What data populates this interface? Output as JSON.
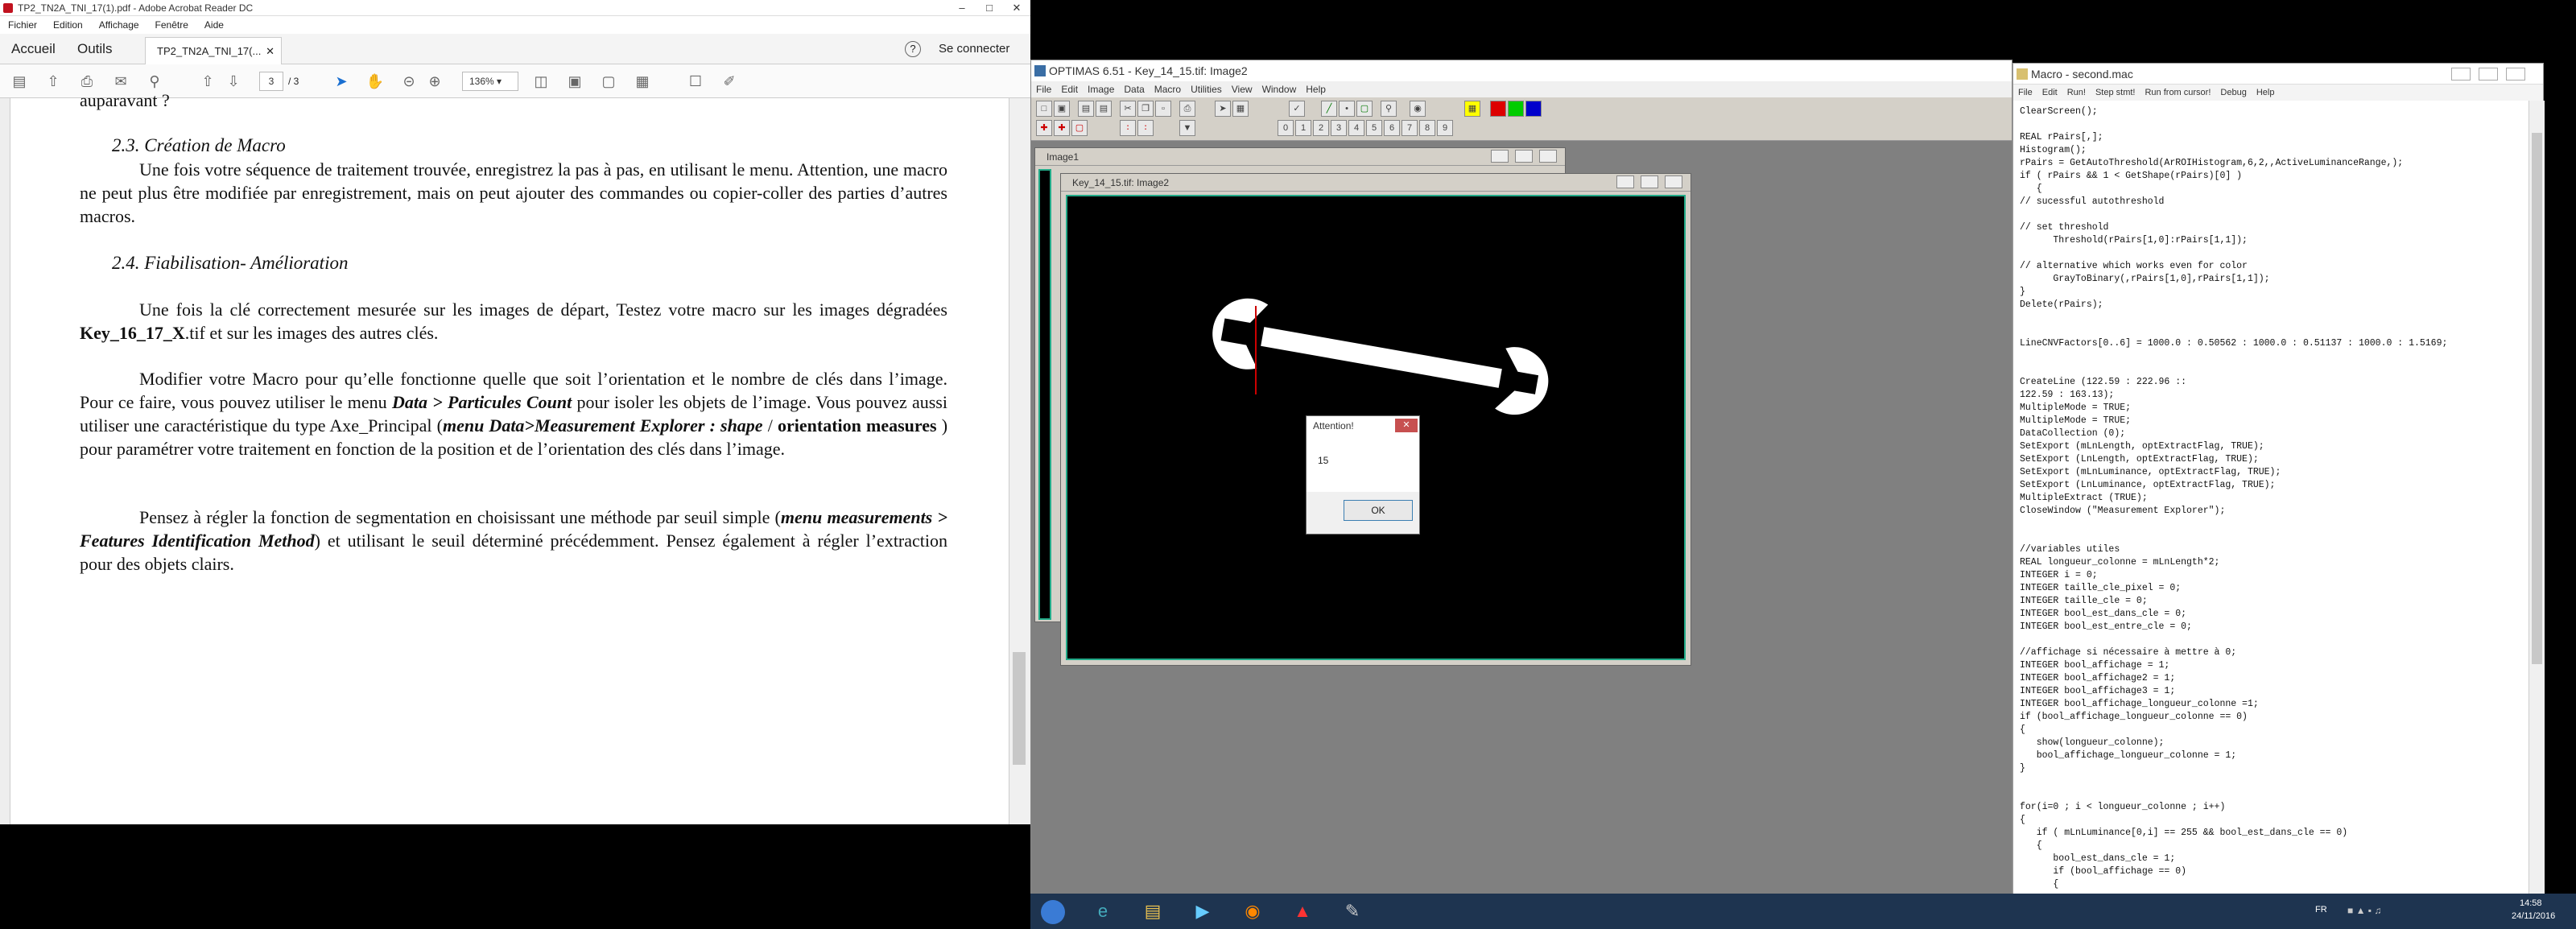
{
  "acrobat": {
    "title": "TP2_TN2A_TNI_17(1).pdf - Adobe Acrobat Reader DC",
    "menu": [
      "Fichier",
      "Edition",
      "Affichage",
      "Fenêtre",
      "Aide"
    ],
    "tabs": {
      "home": "Accueil",
      "tools": "Outils",
      "doc": "TP2_TN2A_TNI_17(..."
    },
    "signin": "Se connecter",
    "page_current": "3",
    "page_total": "/ 3",
    "zoom": "136%",
    "content": {
      "top_fragment": "auparavant ?",
      "h23": "2.3. Création de Macro",
      "p1": "Une fois votre séquence de traitement trouvée, enregistrez la pas à pas, en utilisant le menu. Attention, une macro ne peut plus être modifiée par enregistrement, mais on peut ajouter des commandes ou copier-coller des parties d’autres macros.",
      "h24": "2.4. Fiabilisation- Amélioration",
      "p2a": "Une fois la clé correctement mesurée sur les images de départ, Testez votre macro sur les images dégradées",
      "p2b": "Key_16_17_X",
      "p2c": ".tif et sur les images des autres clés.",
      "p3a": "Modifier votre Macro pour qu’elle fonctionne quelle que soit l’orientation et le nombre de clés dans l’image. Pour ce faire, vous pouvez utiliser le menu",
      "p3b": "Data > Particules Count",
      "p3c": "pour isoler les objets de l’image. Vous pouvez aussi utiliser une caractéristique du type Axe_Principal (",
      "p3d": "menu Data>Measurement Explorer : shape",
      "p3e": "/",
      "p3f": "orientation measures",
      "p3g": ") pour paramétrer votre traitement en fonction de la position et de l’orientation des clés dans l’image.",
      "p4a": "Pensez à régler la fonction de segmentation en choisissant une méthode par seuil simple (",
      "p4b": "menu measurements > Features Identification Method",
      "p4c": ") et utilisant le seuil déterminé précédemment. Pensez également à régler l’extraction pour des objets clairs."
    }
  },
  "optimas": {
    "title": "OPTIMAS 6.51 - Key_14_15.tif: Image2",
    "menu": [
      "File",
      "Edit",
      "Image",
      "Data",
      "Macro",
      "Utilities",
      "View",
      "Window",
      "Help"
    ],
    "win1_title": "Image1",
    "win2_title": "Key_14_15.tif: Image2",
    "numbuttons": [
      "0",
      "1",
      "2",
      "3",
      "4",
      "5",
      "6",
      "7",
      "8",
      "9"
    ]
  },
  "dialog": {
    "title": "Attention!",
    "message": "15",
    "ok": "OK"
  },
  "macro": {
    "title": "Macro - second.mac",
    "menu": [
      "File",
      "Edit",
      "Run!",
      "Step stmt!",
      "Run from cursor!",
      "Debug",
      "Help"
    ],
    "code": "ClearScreen();\n\nREAL rPairs[,];\nHistogram();\nrPairs = GetAutoThreshold(ArROIHistogram,6,2,,ActiveLuminanceRange,);\nif ( rPairs && 1 < GetShape(rPairs)[0] )\n   {\n// sucessful autothreshold\n\n// set threshold\n      Threshold(rPairs[1,0]:rPairs[1,1]);\n\n// alternative which works even for color\n      GrayToBinary(,rPairs[1,0],rPairs[1,1]);\n}\nDelete(rPairs);\n\n\nLineCNVFactors[0..6] = 1000.0 : 0.50562 : 1000.0 : 0.51137 : 1000.0 : 1.5169;\n\n\nCreateLine (122.59 : 222.96 ::\n122.59 : 163.13);\nMultipleMode = TRUE;\nMultipleMode = TRUE;\nDataCollection (0);\nSetExport (mLnLength, optExtractFlag, TRUE);\nSetExport (LnLength, optExtractFlag, TRUE);\nSetExport (mLnLuminance, optExtractFlag, TRUE);\nSetExport (LnLuminance, optExtractFlag, TRUE);\nMultipleExtract (TRUE);\nCloseWindow (\"Measurement Explorer\");\n\n\n//variables utiles\nREAL longueur_colonne = mLnLength*2;\nINTEGER i = 0;\nINTEGER taille_cle_pixel = 0;\nINTEGER taille_cle = 0;\nINTEGER bool_est_dans_cle = 0;\nINTEGER bool_est_entre_cle = 0;\n\n//affichage si nécessaire à mettre à 0;\nINTEGER bool_affichage = 1;\nINTEGER bool_affichage2 = 1;\nINTEGER bool_affichage3 = 1;\nINTEGER bool_affichage_longueur_colonne =1;\nif (bool_affichage_longueur_colonne == 0)\n{\n   show(longueur_colonne);\n   bool_affichage_longueur_colonne = 1;\n}\n\n\nfor(i=0 ; i < longueur_colonne ; i++)\n{\n   if ( mLnLuminance[0,i] == 255 && bool_est_dans_cle == 0)\n   {\n      bool_est_dans_cle = 1;\n      if (bool_affichage == 0)\n      {"
  },
  "taskbar": {
    "lang": "FR",
    "time": "14:58",
    "date": "24/11/2016"
  }
}
